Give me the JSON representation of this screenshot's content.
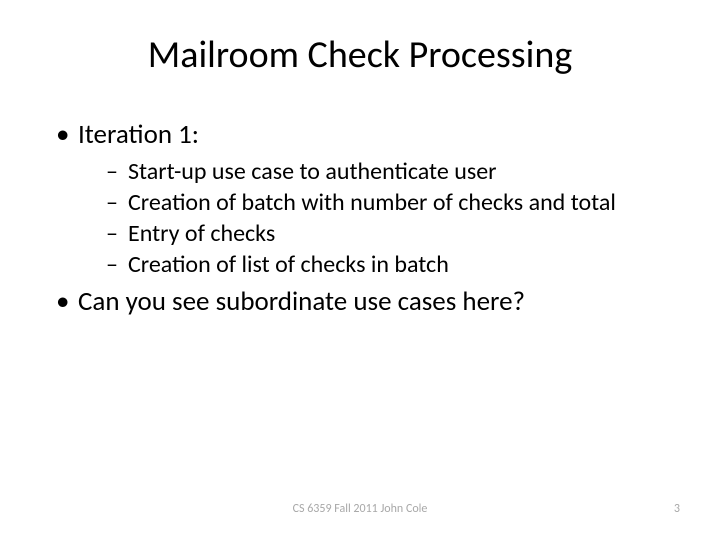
{
  "title": "Mailroom Check Processing",
  "bullets": {
    "b0": {
      "text": "Iteration 1:"
    },
    "b0_sub": {
      "s0": "Start-up use case to authenticate user",
      "s1": "Creation of batch with number of checks and total",
      "s2": "Entry of checks",
      "s3": "Creation of list of checks in batch"
    },
    "b1": {
      "text": "Can you see subordinate use cases here?"
    }
  },
  "footer": {
    "center": "CS 6359 Fall 2011 John Cole",
    "page": "3"
  }
}
